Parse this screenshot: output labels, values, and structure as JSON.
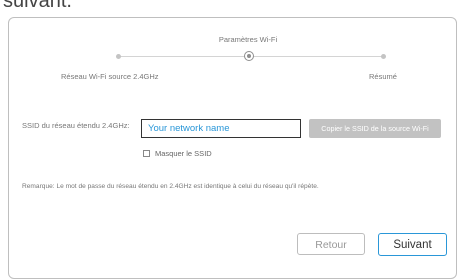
{
  "page": {
    "heading": "suivant."
  },
  "steps": {
    "current_title": "Paramètres Wi-Fi",
    "items": [
      {
        "label": "Réseau Wi-Fi source 2.4GHz",
        "state": "completed"
      },
      {
        "label": "",
        "state": "current"
      },
      {
        "label": "Résumé",
        "state": "upcoming"
      }
    ]
  },
  "form": {
    "ssid_label": "SSID du réseau étendu 2.4GHz:",
    "ssid_placeholder": "Your network name",
    "ssid_value": "",
    "copy_button": "Copier le SSID de la source Wi-Fi",
    "hide_ssid_label": "Masquer le SSID",
    "hide_ssid_checked": false
  },
  "remark": "Remarque: Le mot de passe du réseau étendu en 2.4GHz est identique à celui du réseau qu'il répète.",
  "footer": {
    "back_label": "Retour",
    "next_label": "Suivant"
  },
  "colors": {
    "accent": "#2a97d8",
    "disabled_button": "#c2c2c2",
    "border": "#bfbfbf"
  }
}
